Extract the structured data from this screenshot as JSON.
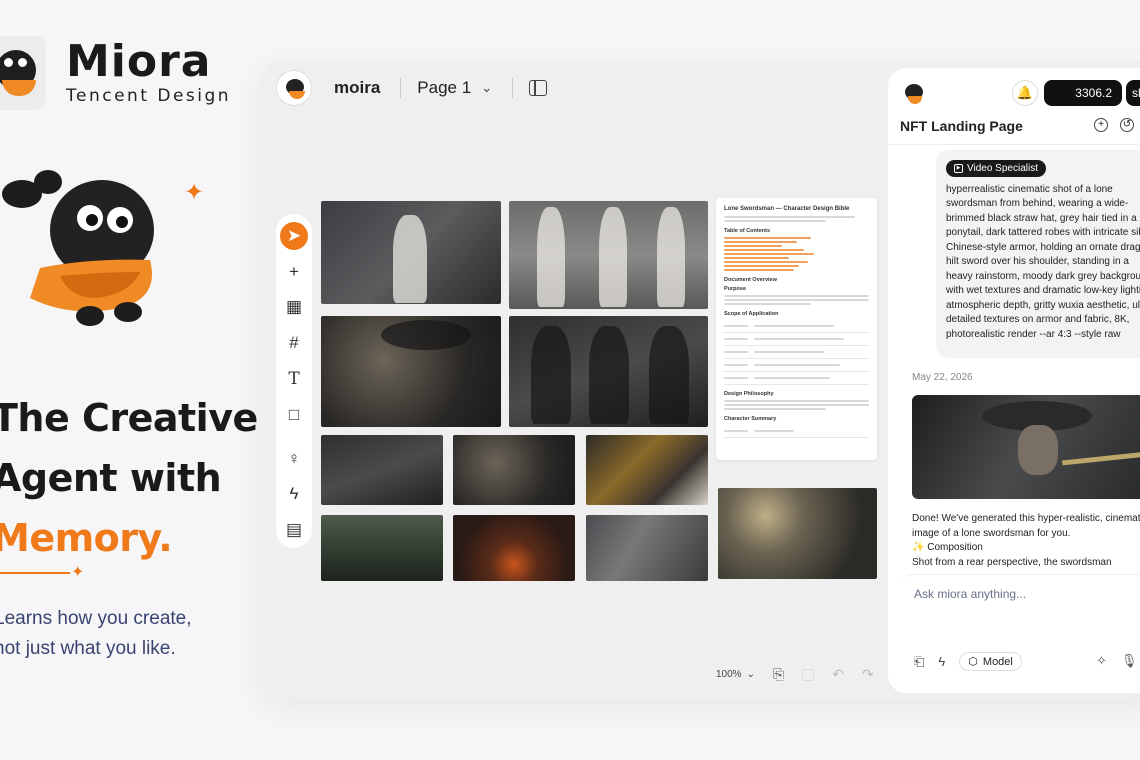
{
  "brand": {
    "name": "Miora",
    "sub": "Tencent Design"
  },
  "marketing": {
    "headline_line1": "The Creative",
    "headline_line2": "Agent with",
    "headline_accent": "Memory.",
    "tagline_line1": "Learns how you create,",
    "tagline_line2": "not just what you like."
  },
  "app": {
    "project_name": "moira",
    "page_label": "Page 1",
    "zoom_label": "100%",
    "tools": [
      "select-icon",
      "plus-icon",
      "grid-icon",
      "frame-icon",
      "text-icon",
      "rectangle-icon",
      "bulb-icon",
      "bolt-icon",
      "layout-icon"
    ]
  },
  "doc": {
    "title": "Lone Swordsman — Character Design Bible",
    "toc": "Table of Contents",
    "overview": "Document Overview",
    "purpose": "Purpose",
    "scope": "Scope of Application",
    "design": "Design Philosophy",
    "summary": "Character Summary"
  },
  "chat": {
    "credits": "3306.2",
    "share_label": "sh",
    "title": "NFT Landing Page",
    "pill_label": "Video Specialist",
    "prompt": "hyperrealistic cinematic shot of a lone swordsman from behind, wearing a wide-brimmed black straw hat, grey hair tied in a ponytail, dark tattered robes with intricate silver Chinese-style armor, holding an ornate dragon-hilt sword over his shoulder, standing in a heavy rainstorm, moody dark grey background with wet textures and dramatic low-key lighting, atmospheric depth, gritty wuxia aesthetic, ultra-detailed textures on armor and fabric, 8K, photorealistic render --ar 4:3 --style raw",
    "date": "May 22, 2026",
    "reply_line1": "Done! We've generated this hyper-realistic, cinematic",
    "reply_line2": "image of a lone swordsman for you.",
    "reply_line3": "✨ Composition",
    "reply_line4": "Shot from a rear perspective, the swordsman",
    "input_placeholder": "Ask miora anything...",
    "model_label": "Model"
  },
  "colors": {
    "accent": "#f07a1a",
    "background": "#f6f6f8",
    "dark_button": "#111111"
  }
}
